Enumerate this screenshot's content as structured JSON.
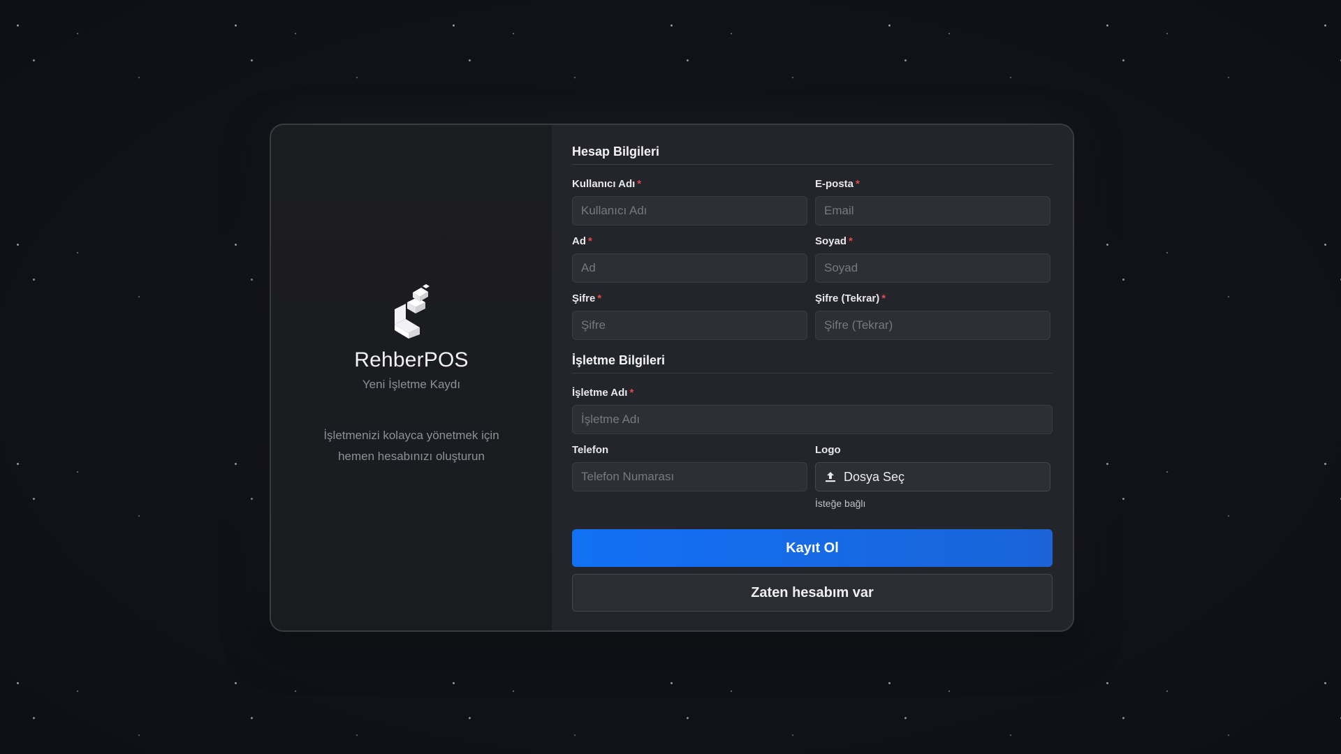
{
  "brand": {
    "name": "RehberPOS",
    "subtitle": "Yeni İşletme Kaydı",
    "description": "İşletmenizi kolayca yönetmek için hemen hesabınızı oluşturun",
    "logo_icon": "stacked-blocks-logo"
  },
  "account_section": {
    "title": "Hesap Bilgileri",
    "fields": {
      "username": {
        "label": "Kullanıcı Adı",
        "required_mark": "*",
        "placeholder": "Kullanıcı Adı",
        "value": ""
      },
      "email": {
        "label": "E-posta",
        "required_mark": "*",
        "placeholder": "Email",
        "value": ""
      },
      "first_name": {
        "label": "Ad",
        "required_mark": "*",
        "placeholder": "Ad",
        "value": ""
      },
      "last_name": {
        "label": "Soyad",
        "required_mark": "*",
        "placeholder": "Soyad",
        "value": ""
      },
      "password": {
        "label": "Şifre",
        "required_mark": "*",
        "placeholder": "Şifre",
        "value": ""
      },
      "password_repeat": {
        "label": "Şifre (Tekrar)",
        "required_mark": "*",
        "placeholder": "Şifre (Tekrar)",
        "value": ""
      }
    }
  },
  "business_section": {
    "title": "İşletme Bilgileri",
    "fields": {
      "business_name": {
        "label": "İşletme Adı",
        "required_mark": "*",
        "placeholder": "İşletme Adı",
        "value": ""
      },
      "phone": {
        "label": "Telefon",
        "placeholder": "Telefon Numarası",
        "value": ""
      },
      "logo": {
        "label": "Logo",
        "button_label": "Dosya Seç",
        "button_icon": "upload-icon",
        "hint": "İsteğe bağlı"
      }
    }
  },
  "actions": {
    "register_label": "Kayıt Ol",
    "login_label": "Zaten hesabım var"
  },
  "colors": {
    "background": "#101218",
    "card": "#1c1d21",
    "form_panel": "#24252a",
    "primary": "#1270f5",
    "required": "#e5484d"
  }
}
